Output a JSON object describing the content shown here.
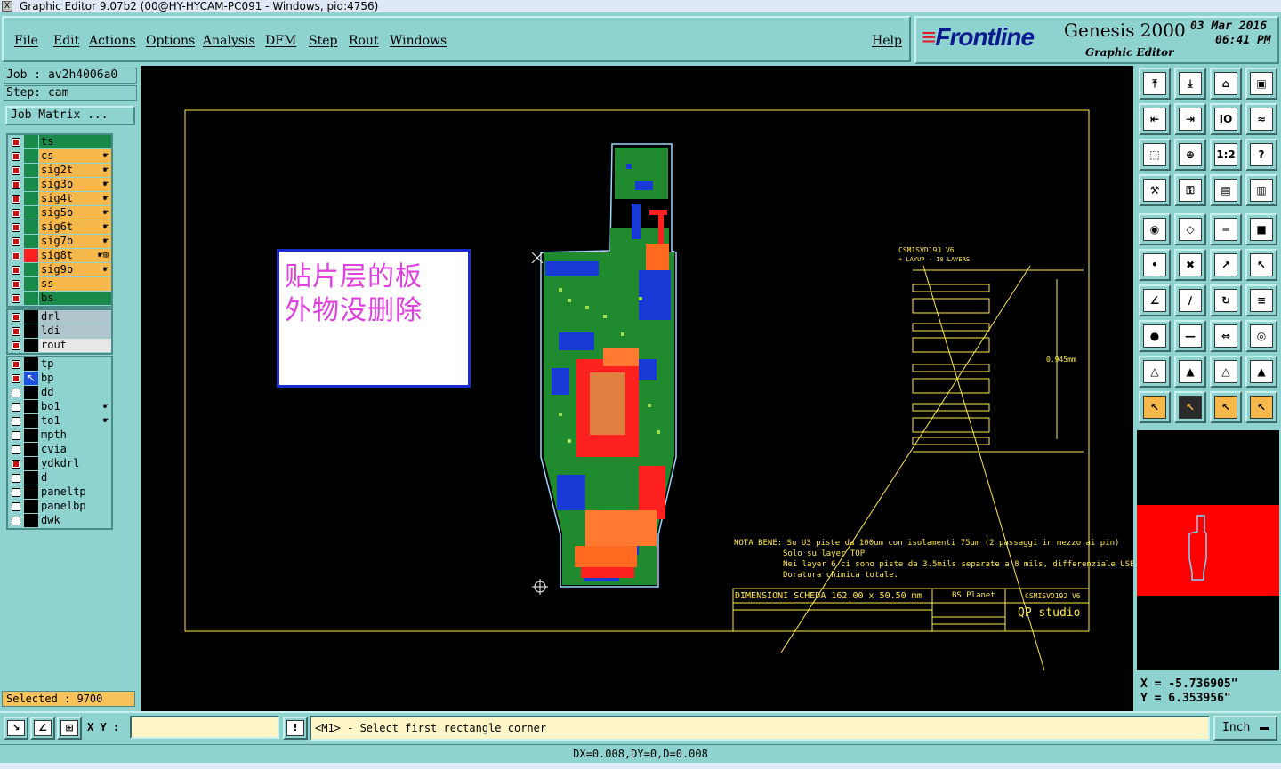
{
  "window": {
    "title": "Graphic Editor 9.07b2 (00@HY-HYCAM-PC091 - Windows, pid:4756)"
  },
  "menu": {
    "items": [
      "File",
      "Edit",
      "Actions",
      "Options",
      "Analysis",
      "DFM",
      "Step",
      "Rout",
      "Windows"
    ],
    "help": "Help"
  },
  "brand": {
    "logo": "Frontline",
    "product": "Genesis 2000",
    "subtitle": "Graphic Editor",
    "date": "03 Mar 2016",
    "time": "06:41 PM"
  },
  "job": {
    "job_label": "Job : av2h4006a0",
    "step_label": "Step: cam",
    "matrix_button": "Job Matrix ..."
  },
  "layer_groups": [
    [
      {
        "name": "ts",
        "color": "#1a8a4a",
        "checked": true,
        "mark": ""
      },
      {
        "name": "cs",
        "color": "#f6b84a",
        "checked": true,
        "mark": "☛"
      },
      {
        "name": "sig2t",
        "color": "#f6b84a",
        "checked": true,
        "mark": "☛"
      },
      {
        "name": "sig3b",
        "color": "#f6b84a",
        "checked": true,
        "mark": "☛"
      },
      {
        "name": "sig4t",
        "color": "#f6b84a",
        "checked": true,
        "mark": "☛"
      },
      {
        "name": "sig5b",
        "color": "#f6b84a",
        "checked": true,
        "mark": "☛"
      },
      {
        "name": "sig6t",
        "color": "#f6b84a",
        "checked": true,
        "mark": "☛"
      },
      {
        "name": "sig7b",
        "color": "#f6b84a",
        "checked": true,
        "mark": "☛"
      },
      {
        "name": "sig8t",
        "color": "#f6b84a",
        "checked": true,
        "mark": "☛⊞"
      },
      {
        "name": "sig9b",
        "color": "#f6b84a",
        "checked": true,
        "mark": "☛"
      },
      {
        "name": "ss",
        "color": "#f6b84a",
        "checked": true,
        "mark": ""
      },
      {
        "name": "bs",
        "color": "#1a8a4a",
        "checked": true,
        "mark": ""
      }
    ],
    [
      {
        "name": "drl",
        "color": "#b0c4cc",
        "checked": true,
        "mark": ""
      },
      {
        "name": "ldi",
        "color": "#b0c4cc",
        "checked": true,
        "mark": ""
      },
      {
        "name": "rout",
        "color": "#e8e8e8",
        "checked": true,
        "mark": ""
      }
    ],
    [
      {
        "name": "tp",
        "color": "#8fd3d0",
        "checked": true,
        "mark": ""
      },
      {
        "name": "bp",
        "color": "#8fd3d0",
        "checked": true,
        "mark": ""
      },
      {
        "name": "dd",
        "color": "#8fd3d0",
        "checked": false,
        "mark": ""
      },
      {
        "name": "bo1",
        "color": "#8fd3d0",
        "checked": false,
        "mark": "☛"
      },
      {
        "name": "to1",
        "color": "#8fd3d0",
        "checked": false,
        "mark": "☛"
      },
      {
        "name": "mpth",
        "color": "#8fd3d0",
        "checked": false,
        "mark": ""
      },
      {
        "name": "cvia",
        "color": "#8fd3d0",
        "checked": false,
        "mark": ""
      },
      {
        "name": "ydkdrl",
        "color": "#8fd3d0",
        "checked": true,
        "mark": ""
      },
      {
        "name": "d",
        "color": "#8fd3d0",
        "checked": false,
        "mark": ""
      },
      {
        "name": "paneltp",
        "color": "#8fd3d0",
        "checked": false,
        "mark": ""
      },
      {
        "name": "panelbp",
        "color": "#8fd3d0",
        "checked": false,
        "mark": ""
      },
      {
        "name": "dwk",
        "color": "#8fd3d0",
        "checked": false,
        "mark": ""
      }
    ]
  ],
  "selected": "Selected : 9700",
  "annotation": {
    "line1": "贴片层的板",
    "line2": "外物没删除"
  },
  "drawing": {
    "stackup_title": "CSMISVD193  V6",
    "stackup_sub": "+ LAYUP - 10 LAYERS",
    "thickness": "0.945mm",
    "note_lines": [
      "NOTA BENE: Su U3 piste da 100um con isolamenti 75um (2 passaggi in mezzo ai pin)",
      "Solo su layer TOP",
      "Nei layer 6 ci sono piste da 3.5mils separate a 8 mils, differenziale USB",
      "Doratura chimica totale."
    ],
    "dim_label": "DIMENSIONI SCHEDA  162.00 x 50.50 mm",
    "client_label": "BS Planet",
    "code_label": "CSMISVD192  V6",
    "studio": "QP studio"
  },
  "tools": {
    "rows": [
      [
        "page-icon",
        "page-down-icon",
        "home-icon",
        "window-icon"
      ],
      [
        "pan-left-icon",
        "pan-right-icon",
        "io-icon",
        "zoom-sym-icon"
      ],
      [
        "fit-icon",
        "fit-center-icon",
        "ratio-icon",
        "help-icon"
      ],
      [
        "tool-icon",
        "key-icon",
        "net-red-icon",
        "net-red2-icon"
      ],
      [
        "snap-icon",
        "rotate-icon",
        "ruler-icon",
        "grid-icon"
      ],
      [
        "node-icon",
        "cross-icon",
        "arrow-up-icon",
        "arrow-up2-icon"
      ],
      [
        "angle-icon",
        "line-icon",
        "rotate-ccw-icon",
        "mirror-icon"
      ],
      [
        "red-dot-icon",
        "minus-icon",
        "measure-icon",
        "shapes-icon"
      ],
      [
        "triangle-icon",
        "triangle2-icon",
        "triangle3-icon",
        "triangle4-icon"
      ],
      [
        "select-icon",
        "select-dark-icon",
        "select-orange-icon",
        "select-route-icon"
      ]
    ],
    "labels": [
      [
        "⤒",
        "⤓",
        "⌂",
        "▣"
      ],
      [
        "⇤",
        "⇥",
        "IO",
        "≈"
      ],
      [
        "⬚",
        "⊕",
        "1:2",
        "?"
      ],
      [
        "⚒",
        "⚿",
        "▤",
        "▥"
      ],
      [
        "◉",
        "◇",
        "═",
        "■"
      ],
      [
        "•",
        "✖",
        "↗",
        "↖"
      ],
      [
        "∠",
        "∕",
        "↻",
        "≡"
      ],
      [
        "●",
        "—",
        "⇔",
        "◎"
      ],
      [
        "△",
        "▲",
        "△",
        "▲"
      ],
      [
        "↖",
        "↖",
        "↖",
        "↖"
      ]
    ]
  },
  "coords": {
    "x": "X = -5.736905\"",
    "y": "Y = 6.353956\""
  },
  "bottom": {
    "xy_label": "X Y :",
    "xy_value": "",
    "prompt": "<M1> - Select first rectangle corner",
    "unit": "Inch"
  },
  "status": "DX=0.008,DY=0,D=0.008"
}
